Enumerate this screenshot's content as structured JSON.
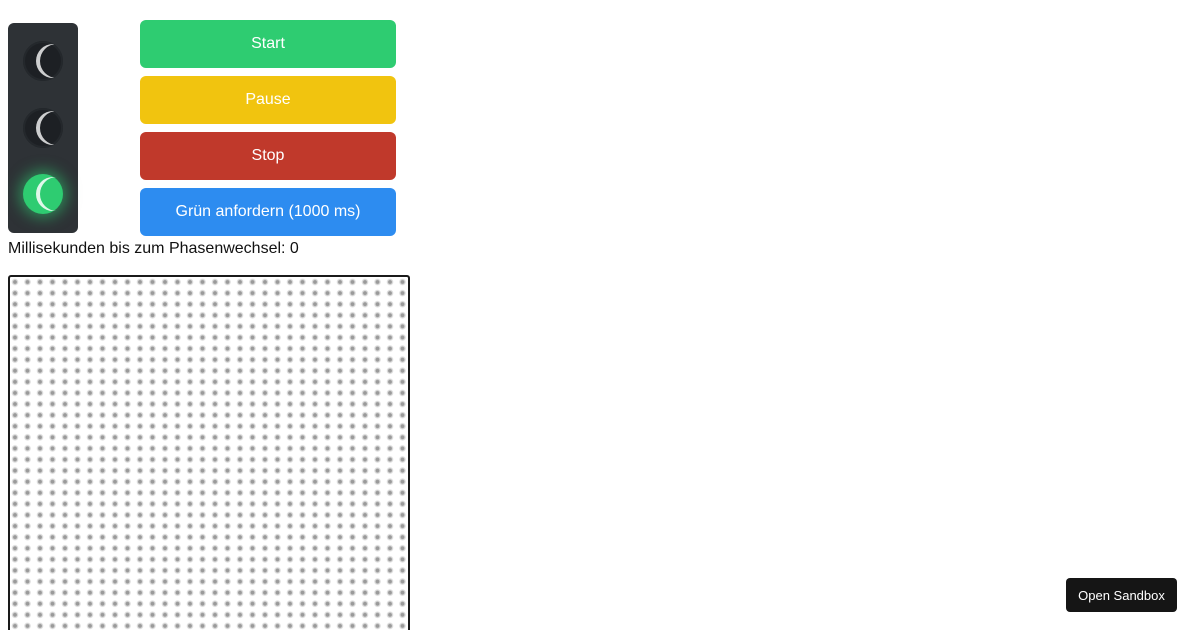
{
  "traffic_light": {
    "lamps": [
      {
        "name": "red",
        "state": "off"
      },
      {
        "name": "yellow",
        "state": "off"
      },
      {
        "name": "green",
        "state": "on",
        "color": "#2ecc71"
      }
    ]
  },
  "controls": {
    "start_label": "Start",
    "pause_label": "Pause",
    "stop_label": "Stop",
    "request_green_label": "Grün anfordern (1000 ms)"
  },
  "colors": {
    "start": "#2ecc71",
    "pause": "#f1c40f",
    "stop": "#c0392b",
    "request": "#2d8cf0",
    "housing": "#2e3236"
  },
  "status": {
    "text": "Millisekunden bis zum Phasenwechsel: 0"
  },
  "sandbox": {
    "label": "Open Sandbox"
  }
}
